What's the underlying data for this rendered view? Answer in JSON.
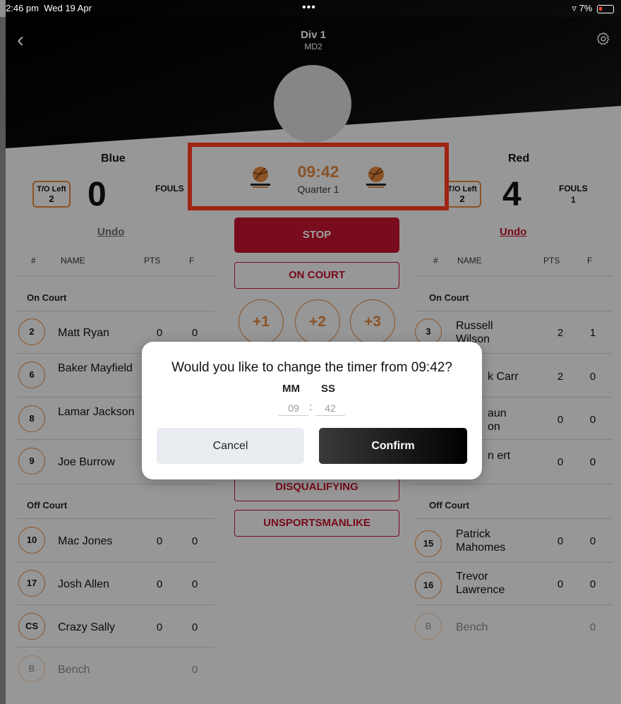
{
  "status_bar": {
    "time": "2:46 pm",
    "date": "Wed 19 Apr",
    "dots": "•••",
    "battery": "7%"
  },
  "header": {
    "title": "Div 1",
    "subtitle": "MD2"
  },
  "clock": {
    "time": "09:42",
    "quarter": "Quarter 1"
  },
  "controls": {
    "stop": "STOP",
    "on_court": "ON COURT",
    "plus1": "+1",
    "plus2": "+2",
    "plus3": "+3",
    "disqualifying": "DISQUALIFYING",
    "unsportsmanlike": "UNSPORTSMANLIKE"
  },
  "columns": {
    "num": "#",
    "name": "NAME",
    "pts": "PTS",
    "f": "F"
  },
  "sections": {
    "on_court": "On Court",
    "off_court": "Off Court"
  },
  "home": {
    "name": "Blue",
    "to_label": "T/O Left",
    "to_value": "2",
    "score": "0",
    "fouls_label": "FOULS",
    "undo": "Undo",
    "on_court": [
      {
        "num": "2",
        "name": "Matt Ryan",
        "pts": "0",
        "f": "0"
      },
      {
        "num": "6",
        "name": "Baker Mayfield",
        "pts": "",
        "f": ""
      },
      {
        "num": "8",
        "name": "Lamar Jackson",
        "pts": "",
        "f": ""
      },
      {
        "num": "9",
        "name": "Joe Burrow",
        "pts": "",
        "f": ""
      }
    ],
    "off_court": [
      {
        "num": "10",
        "name": "Mac Jones",
        "pts": "0",
        "f": "0"
      },
      {
        "num": "17",
        "name": "Josh Allen",
        "pts": "0",
        "f": "0"
      },
      {
        "num": "CS",
        "name": "Crazy Sally",
        "pts": "0",
        "f": "0"
      },
      {
        "num": "B",
        "name": "Bench",
        "pts": "",
        "f": "0"
      }
    ]
  },
  "away": {
    "name": "Red",
    "to_label": "T/O Left",
    "to_value": "2",
    "score": "4",
    "fouls_label": "FOULS",
    "fouls_value": "1",
    "undo": "Undo",
    "on_court": [
      {
        "num": "3",
        "name": "Russell Wilson",
        "pts": "2",
        "f": "1"
      },
      {
        "num": "",
        "name": "k Carr",
        "pts": "2",
        "f": "0"
      },
      {
        "num": "",
        "name": "aun on",
        "pts": "0",
        "f": "0"
      },
      {
        "num": "",
        "name": "n ert",
        "pts": "0",
        "f": "0"
      }
    ],
    "off_court": [
      {
        "num": "15",
        "name": "Patrick Mahomes",
        "pts": "0",
        "f": "0"
      },
      {
        "num": "16",
        "name": "Trevor Lawrence",
        "pts": "0",
        "f": "0"
      },
      {
        "num": "B",
        "name": "Bench",
        "pts": "",
        "f": "0"
      }
    ]
  },
  "dialog": {
    "title": "Would you like to change the timer from 09:42?",
    "mm_label": "MM",
    "ss_label": "SS",
    "mm_value": "09",
    "ss_value": "42",
    "separator": ":",
    "cancel": "Cancel",
    "confirm": "Confirm"
  },
  "colors": {
    "accent_orange": "#e0863e",
    "accent_red": "#c2122e",
    "highlight": "#ff3b1f"
  }
}
